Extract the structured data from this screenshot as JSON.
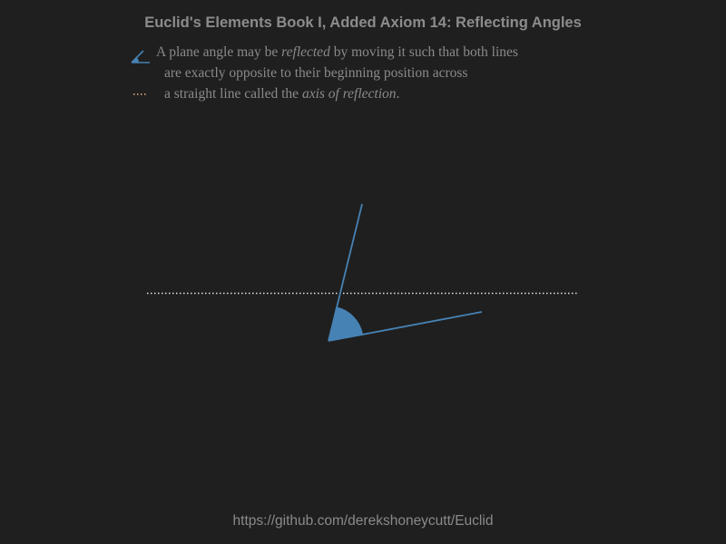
{
  "title": "Euclid's Elements Book I, Added Axiom 14: Reflecting Angles",
  "legend": {
    "line1_pre": "A plane angle may be ",
    "line1_em": "reflected",
    "line1_post": " by moving it such that both lines",
    "line2": "are exactly opposite to their beginning position across",
    "line3_pre": "a straight line called the ",
    "line3_em": "axis of reflection",
    "line3_post": ".",
    "angle_icon": "angle-icon",
    "axis_icon": "dotted-line-icon"
  },
  "colors": {
    "background": "#1f1f1f",
    "angle": "#4682b4",
    "axis": "#e6e6e6",
    "axis_legend": "#e8b888",
    "text": "#8a8a8a"
  },
  "footer": "https://github.com/derekshoneycutt/Euclid"
}
